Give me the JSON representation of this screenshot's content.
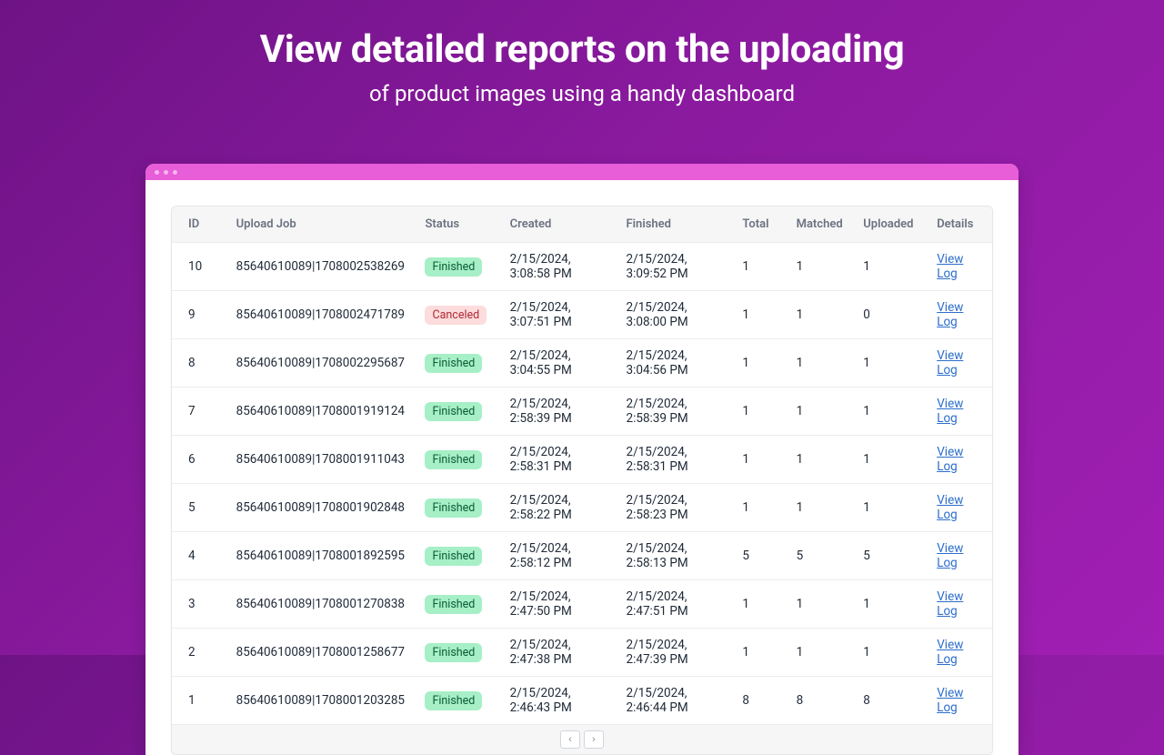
{
  "hero": {
    "title": "View detailed reports on the uploading",
    "subtitle": "of product images using a handy dashboard"
  },
  "headers": {
    "id": "ID",
    "job": "Upload Job",
    "status": "Status",
    "created": "Created",
    "finished": "Finished",
    "total": "Total",
    "matched": "Matched",
    "uploaded": "Uploaded",
    "details": "Details"
  },
  "details_link": "View Log",
  "status_labels": {
    "finished": "Finished",
    "canceled": "Canceled"
  },
  "rows": [
    {
      "id": "10",
      "job": "85640610089|1708002538269",
      "status": "finished",
      "created": "2/15/2024, 3:08:58 PM",
      "finished": "2/15/2024, 3:09:52 PM",
      "total": "1",
      "matched": "1",
      "uploaded": "1"
    },
    {
      "id": "9",
      "job": "85640610089|1708002471789",
      "status": "canceled",
      "created": "2/15/2024, 3:07:51 PM",
      "finished": "2/15/2024, 3:08:00 PM",
      "total": "1",
      "matched": "1",
      "uploaded": "0"
    },
    {
      "id": "8",
      "job": "85640610089|1708002295687",
      "status": "finished",
      "created": "2/15/2024, 3:04:55 PM",
      "finished": "2/15/2024, 3:04:56 PM",
      "total": "1",
      "matched": "1",
      "uploaded": "1"
    },
    {
      "id": "7",
      "job": "85640610089|1708001919124",
      "status": "finished",
      "created": "2/15/2024, 2:58:39 PM",
      "finished": "2/15/2024, 2:58:39 PM",
      "total": "1",
      "matched": "1",
      "uploaded": "1"
    },
    {
      "id": "6",
      "job": "85640610089|1708001911043",
      "status": "finished",
      "created": "2/15/2024, 2:58:31 PM",
      "finished": "2/15/2024, 2:58:31 PM",
      "total": "1",
      "matched": "1",
      "uploaded": "1"
    },
    {
      "id": "5",
      "job": "85640610089|1708001902848",
      "status": "finished",
      "created": "2/15/2024, 2:58:22 PM",
      "finished": "2/15/2024, 2:58:23 PM",
      "total": "1",
      "matched": "1",
      "uploaded": "1"
    },
    {
      "id": "4",
      "job": "85640610089|1708001892595",
      "status": "finished",
      "created": "2/15/2024, 2:58:12 PM",
      "finished": "2/15/2024, 2:58:13 PM",
      "total": "5",
      "matched": "5",
      "uploaded": "5"
    },
    {
      "id": "3",
      "job": "85640610089|1708001270838",
      "status": "finished",
      "created": "2/15/2024, 2:47:50 PM",
      "finished": "2/15/2024, 2:47:51 PM",
      "total": "1",
      "matched": "1",
      "uploaded": "1"
    },
    {
      "id": "2",
      "job": "85640610089|1708001258677",
      "status": "finished",
      "created": "2/15/2024, 2:47:38 PM",
      "finished": "2/15/2024, 2:47:39 PM",
      "total": "1",
      "matched": "1",
      "uploaded": "1"
    },
    {
      "id": "1",
      "job": "85640610089|1708001203285",
      "status": "finished",
      "created": "2/15/2024, 2:46:43 PM",
      "finished": "2/15/2024, 2:46:44 PM",
      "total": "8",
      "matched": "8",
      "uploaded": "8"
    }
  ]
}
